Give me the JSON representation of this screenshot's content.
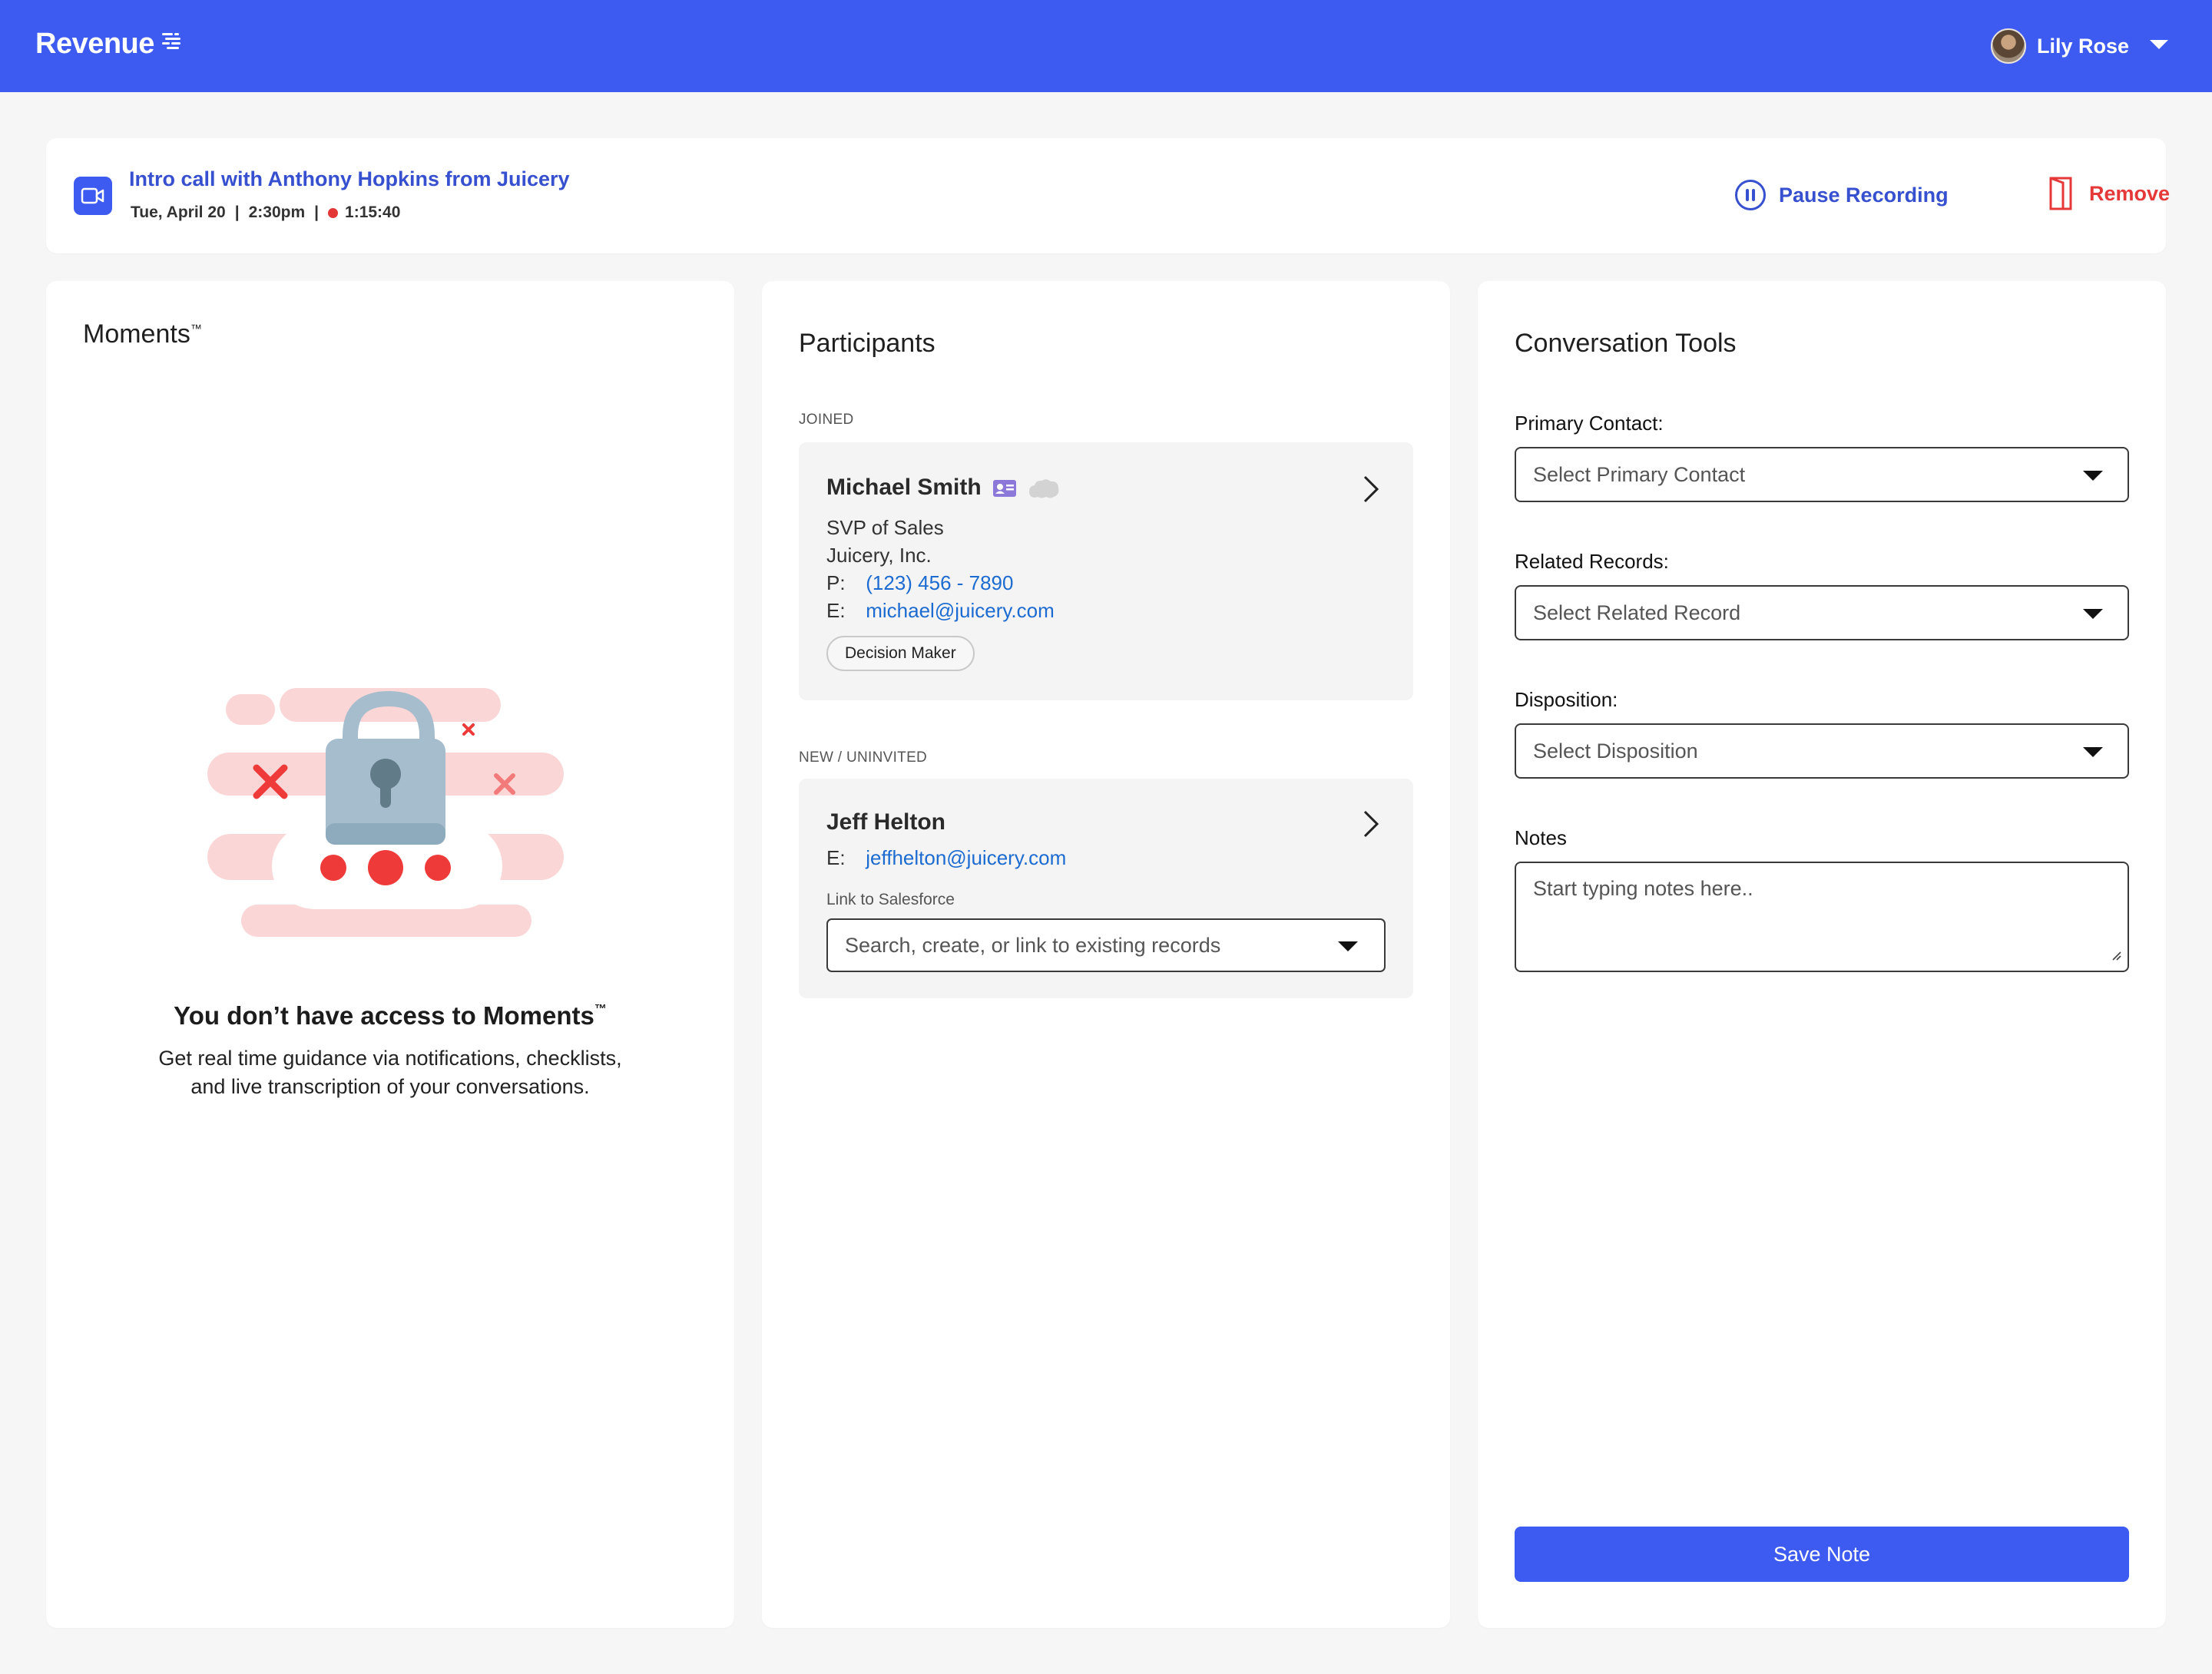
{
  "app": {
    "brand": "Revenue",
    "accent": "#3e5bf1",
    "user": {
      "name": "Lily Rose"
    }
  },
  "call": {
    "title": "Intro call with Anthony Hopkins from Juicery",
    "date": "Tue, April 20",
    "time": "2:30pm",
    "duration": "1:15:40",
    "pause_label": "Pause Recording",
    "remove_label": "Remove"
  },
  "moments": {
    "title": "Moments",
    "trademark": "™",
    "no_access_title": "You don’t have access to Moments",
    "no_access_desc_line1": "Get real time guidance via notifications, checklists,",
    "no_access_desc_line2": "and live transcription of your conversations."
  },
  "participants": {
    "title": "Participants",
    "joined_label": "JOINED",
    "new_label": "NEW / UNINVITED",
    "joined": {
      "name": "Michael Smith",
      "role": "SVP of Sales",
      "company": "Juicery, Inc.",
      "phone_key": "P:",
      "phone": "(123) 456 - 7890",
      "email_key": "E:",
      "email": "michael@juicery.com",
      "tag": "Decision Maker"
    },
    "uninvited": {
      "name": "Jeff Helton",
      "email_key": "E:",
      "email": "jeffhelton@juicery.com",
      "link_label": "Link to Salesforce",
      "link_placeholder": "Search, create, or link to existing records"
    }
  },
  "tools": {
    "title": "Conversation Tools",
    "primary_contact_label": "Primary Contact:",
    "primary_contact_value": "Select Primary Contact",
    "related_records_label": "Related Records:",
    "related_records_value": "Select Related Record",
    "disposition_label": "Disposition:",
    "disposition_value": "Select Disposition",
    "notes_label": "Notes",
    "notes_placeholder": "Start typing notes here..",
    "save_label": "Save Note"
  }
}
